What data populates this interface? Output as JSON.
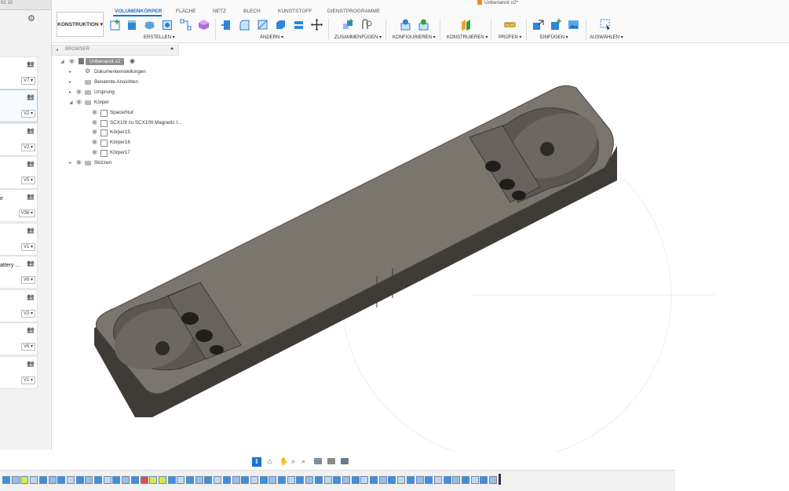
{
  "app": {
    "doc_title": "Unbenannt v2*",
    "title_icon": "cube-icon",
    "topleft_partial": "01 10"
  },
  "left_panel": {
    "gear_icon": "gear-icon",
    "cards": [
      {
        "name": "",
        "version": "V7 ▾"
      },
      {
        "name": "",
        "version": "V2 ▾"
      },
      {
        "name": "",
        "version": "V2 ▾"
      },
      {
        "name": "",
        "version": "V5 ▾"
      },
      {
        "name": "e",
        "version": "V36 ▾"
      },
      {
        "name": "",
        "version": "V1 ▾"
      },
      {
        "name": "attery ...",
        "version": "V6 ▾"
      },
      {
        "name": "",
        "version": "V3 ▾"
      },
      {
        "name": "",
        "version": "V6 ▾"
      },
      {
        "name": "",
        "version": "V1 ▾"
      }
    ]
  },
  "toolbar": {
    "workspace": "KONSTRUKTION ▾",
    "tabs": [
      "VOLUMENKÖRPER",
      "FLÄCHE",
      "NETZ",
      "BLECH",
      "KUNSTSTOFF",
      "DIENSTPROGRAMME"
    ],
    "active_tab": "VOLUMENKÖRPER",
    "groups": [
      "ERSTELLEN ▾",
      "ÄNDERN ▾",
      "ZUSAMMENFÜGEN ▾",
      "KONFIGURIEREN ▾",
      "KONSTRUIEREN ▾",
      "PRÜFEN ▾",
      "EINFÜGEN ▾",
      "AUSWÄHLEN ▾"
    ],
    "accent": "#1b74c5"
  },
  "browser": {
    "header": "BROWSER",
    "root": "Unbenannt v2",
    "items": [
      {
        "label": "Dokumenteinstellungen",
        "icon": "gear-icon"
      },
      {
        "label": "Benannte Ansichten",
        "icon": "folder-icon"
      },
      {
        "label": "Ursprung",
        "icon": "folder-icon"
      },
      {
        "label": "Körper",
        "icon": "folder-icon"
      },
      {
        "label": "SpacerNut",
        "icon": "body-icon"
      },
      {
        "label": "SCX10I zu SCX10II Magnetic I...",
        "icon": "body-icon"
      },
      {
        "label": "Körper15",
        "icon": "body-icon"
      },
      {
        "label": "Körper16",
        "icon": "body-icon"
      },
      {
        "label": "Körper17",
        "icon": "body-icon"
      },
      {
        "label": "Skizzen",
        "icon": "folder-icon"
      }
    ]
  },
  "navbar": {
    "icons": [
      "orbit-icon",
      "pan-icon",
      "zoom-icon",
      "fit-icon",
      "display-icon",
      "grid-icon",
      "viewport-icon"
    ]
  },
  "timeline": {
    "feature_count": 54,
    "marker_icon": "timeline-marker-icon"
  },
  "model": {
    "body_color": "#6f6a62",
    "top_color": "#7a766e"
  }
}
